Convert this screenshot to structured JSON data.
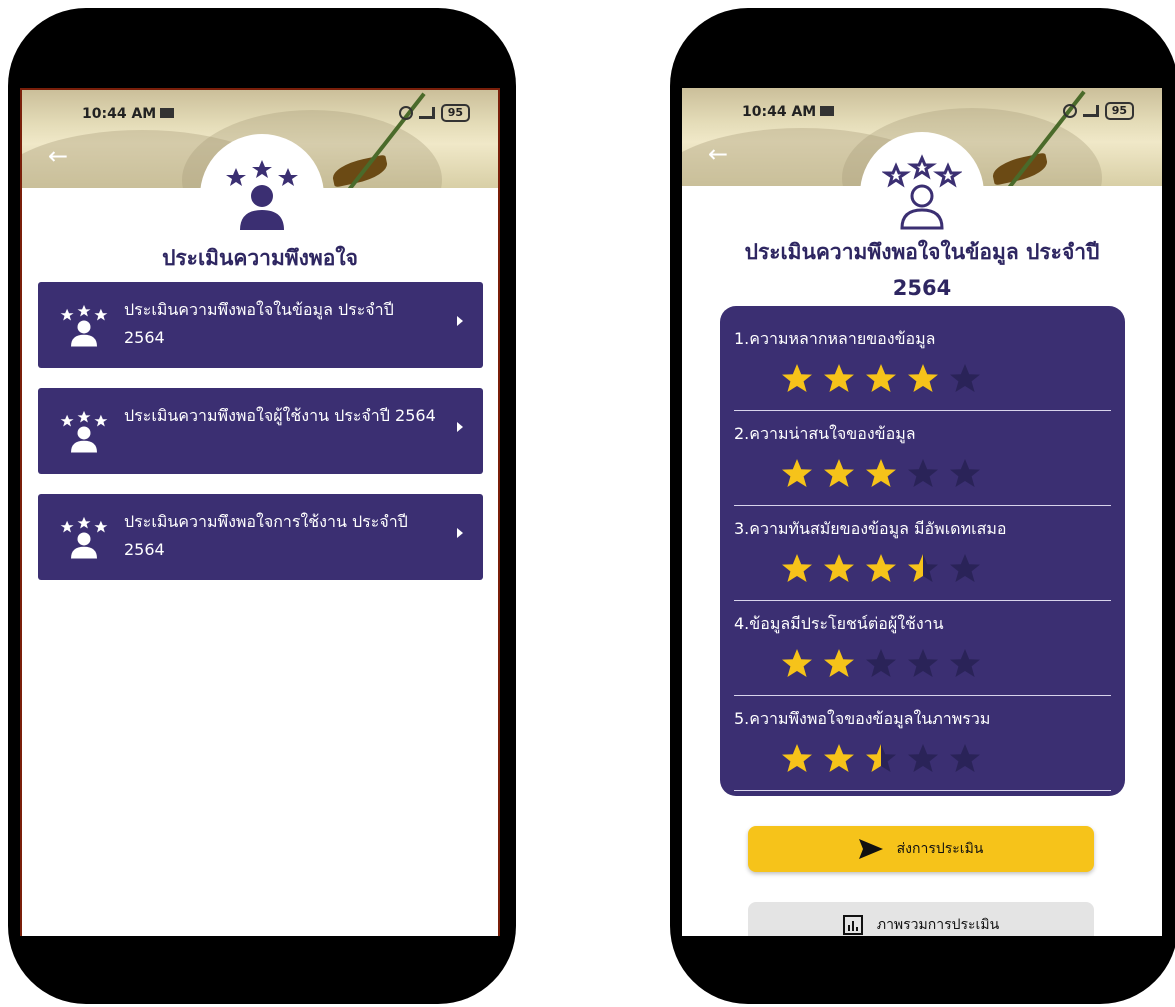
{
  "status_bar": {
    "time": "10:44 AM",
    "battery": "95"
  },
  "left_screen": {
    "title": "ประเมินความพึงพอใจ",
    "menu": [
      {
        "label": "ประเมินความพึงพอใจในข้อมูล ประจำปี 2564"
      },
      {
        "label": "ประเมินความพึงพอใจผู้ใช้งาน ประจำปี 2564"
      },
      {
        "label": "ประเมินความพึงพอใจการใช้งาน ประจำปี 2564"
      }
    ]
  },
  "right_screen": {
    "title_line1": "ประเมินความพึงพอใจในข้อมูล ประจำปี",
    "title_line2": "2564",
    "questions": [
      {
        "label": "1.ความหลากหลายของข้อมูล",
        "rating": 4,
        "max": 5
      },
      {
        "label": "2.ความน่าสนใจของข้อมูล",
        "rating": 3,
        "max": 5
      },
      {
        "label": "3.ความทันสมัยของข้อมูล มีอัพเดทเสมอ",
        "rating": 3.5,
        "max": 5
      },
      {
        "label": "4.ข้อมูลมีประโยชน์ต่อผู้ใช้งาน",
        "rating": 2,
        "max": 5
      },
      {
        "label": "5.ความพึงพอใจของข้อมูลในภาพรวม",
        "rating": 2.5,
        "max": 5
      }
    ],
    "submit_label": "ส่งการประเมิน",
    "summary_label": "ภาพรวมการประเมิน"
  },
  "colors": {
    "primary": "#3b2f72",
    "star_on": "#f6c31a",
    "star_off": "#2a2358",
    "button_yellow": "#f6c31a"
  },
  "icons": [
    "back-arrow-icon",
    "rating-person-icon",
    "send-icon",
    "chart-icon",
    "alarm-icon",
    "signal-icon",
    "mail-icon"
  ]
}
